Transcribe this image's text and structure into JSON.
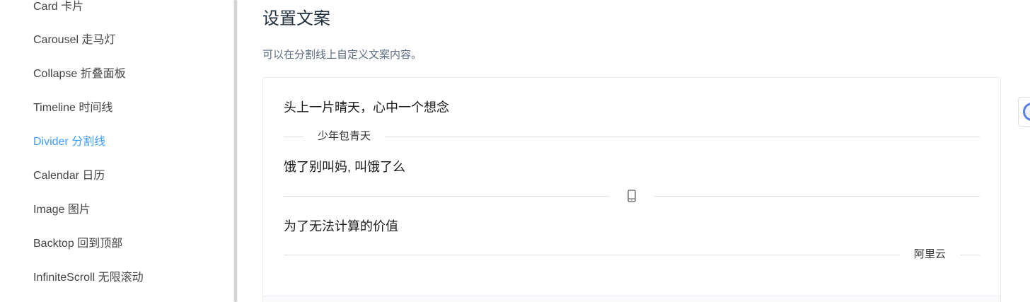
{
  "sidebar": {
    "items": [
      {
        "label": "Card 卡片"
      },
      {
        "label": "Carousel 走马灯"
      },
      {
        "label": "Collapse 折叠面板"
      },
      {
        "label": "Timeline 时间线"
      },
      {
        "label": "Divider 分割线"
      },
      {
        "label": "Calendar 日历"
      },
      {
        "label": "Image 图片"
      },
      {
        "label": "Backtop 回到顶部"
      },
      {
        "label": "InfiniteScroll 无限滚动"
      }
    ],
    "active_index": 4
  },
  "main": {
    "title": "设置文案",
    "description": "可以在分割线上自定义文案内容。",
    "demo": {
      "lines": [
        "头上一片晴天，心中一个想念",
        "饿了别叫妈, 叫饿了么",
        "为了无法计算的价值"
      ],
      "dividers": [
        {
          "position": "left",
          "text": "少年包青天"
        },
        {
          "position": "center",
          "icon": "mobile-phone-icon"
        },
        {
          "position": "right",
          "text": "阿里云"
        }
      ]
    }
  },
  "colors": {
    "accent": "#409EFF",
    "divider": "#dcdfe6",
    "title": "#1f2f3d",
    "description": "#5e6d82"
  }
}
